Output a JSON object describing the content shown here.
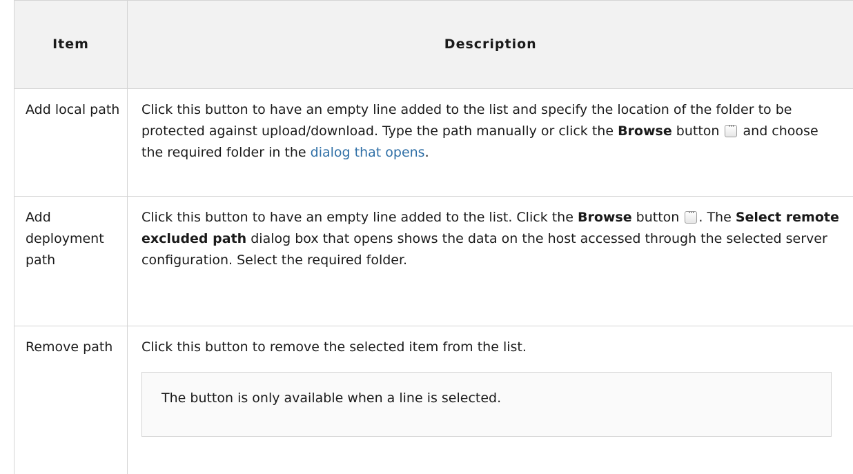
{
  "table": {
    "headers": {
      "item": "Item",
      "description": "Description"
    },
    "rows": [
      {
        "item": "Add local path",
        "desc_part1": "Click this button to have an empty line added to the list and specify the location of the folder to be protected against upload/download. Type the path manually or click the ",
        "desc_bold1": "Browse",
        "desc_part2": " button ",
        "desc_part3": " and choose the required folder in the ",
        "desc_link": "dialog that opens",
        "desc_part4": "."
      },
      {
        "item": "Add deployment path",
        "desc_part1": "Click this button to have an empty line added to the list. Click the ",
        "desc_bold1": "Browse",
        "desc_part2": " button ",
        "desc_part3": ". The ",
        "desc_bold2": "Select remote excluded path",
        "desc_part4": " dialog box that opens shows the data on the host accessed through the selected server configuration. Select the required folder."
      },
      {
        "item": "Remove path",
        "desc": "Click this button to remove the selected item from the list.",
        "note": "The button is only available when a line is selected."
      }
    ]
  },
  "icons": {
    "browse_button": "ellipsis-browse-icon"
  }
}
